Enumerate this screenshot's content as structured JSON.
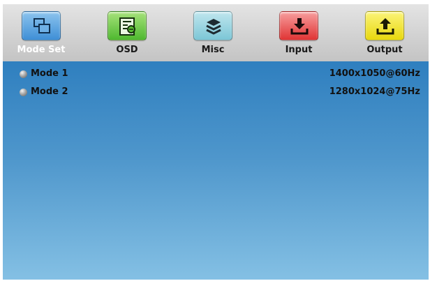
{
  "tabs": [
    {
      "label": "Mode Set",
      "icon": "windows-icon",
      "color": "#4a9be0",
      "active": true
    },
    {
      "label": "OSD",
      "icon": "document-list-icon",
      "color": "#5cc035",
      "active": false
    },
    {
      "label": "Misc",
      "icon": "stack-icon",
      "color": "#8fcfdd",
      "active": false
    },
    {
      "label": "Input",
      "icon": "download-tray-icon",
      "color": "#e84545",
      "active": false
    },
    {
      "label": "Output",
      "icon": "upload-tray-icon",
      "color": "#ece020",
      "active": false
    }
  ],
  "modes": [
    {
      "name": "Mode 1",
      "resolution": "1400x1050@60Hz"
    },
    {
      "name": "Mode 2",
      "resolution": "1280x1024@75Hz"
    }
  ]
}
